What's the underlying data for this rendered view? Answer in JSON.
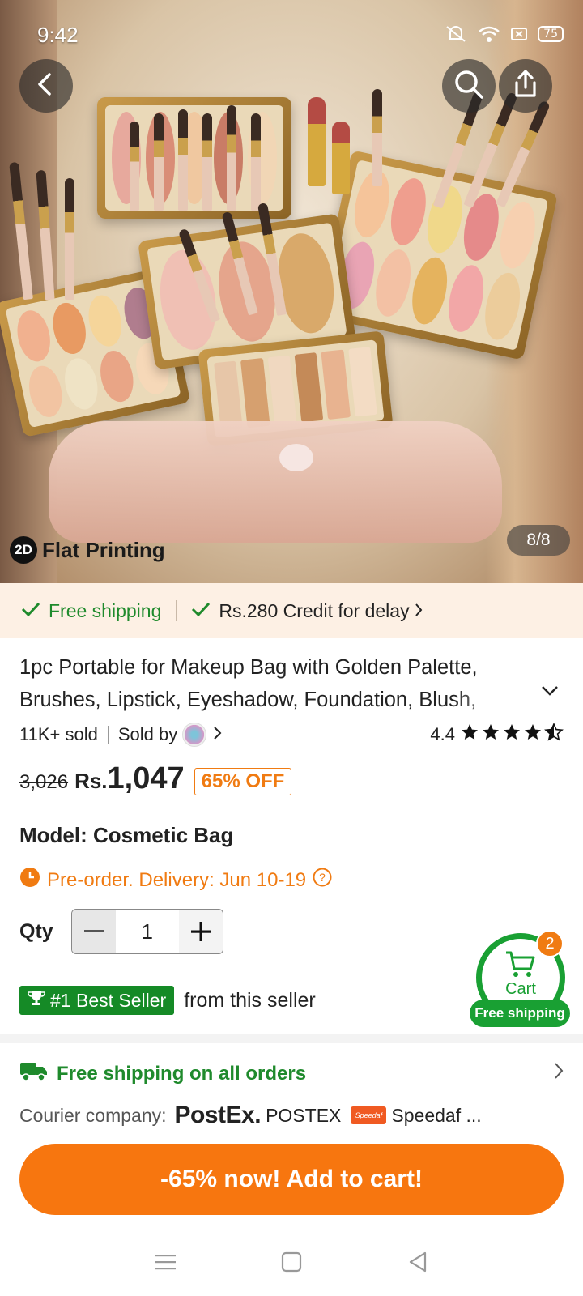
{
  "status_bar": {
    "time": "9:42",
    "battery": "75"
  },
  "gallery": {
    "tag_badge": "2D",
    "tag_text": "Flat Printing",
    "counter": "8/8"
  },
  "shipping_strip": {
    "free_shipping": "Free shipping",
    "credit": "Rs.280 Credit for delay"
  },
  "product": {
    "title": "1pc Portable for Makeup Bag with Golden Palette, Brushes, Lipstick, Eyeshadow, Foundation, Blush,",
    "sold": "11K+ sold",
    "sold_by": "Sold by",
    "rating": "4.4",
    "stars": 4.4,
    "old_price": "3,026",
    "currency": "Rs.",
    "price": "1,047",
    "discount": "65% OFF",
    "model": "Model: Cosmetic Bag",
    "preorder": "Pre-order. Delivery: Jun 10-19",
    "qty_label": "Qty",
    "qty_value": "1"
  },
  "best_seller": {
    "badge": "#1 Best Seller",
    "text": "from this seller"
  },
  "cart_float": {
    "label": "Cart",
    "count": "2",
    "free_shipping": "Free shipping"
  },
  "shipping_info": {
    "title": "Free shipping on all orders",
    "courier_label": "Courier company:",
    "postex_logo": "PostEx.",
    "postex_name": "POSTEX",
    "speedaf_logo": "Speedaf",
    "speedaf_name": "Speedaf ..."
  },
  "add_to_cart": "-65% now! Add to cart!",
  "colors": {
    "accent_orange": "#f7760f",
    "green": "#1f8a2c",
    "strip_bg": "#fdf0e4"
  }
}
